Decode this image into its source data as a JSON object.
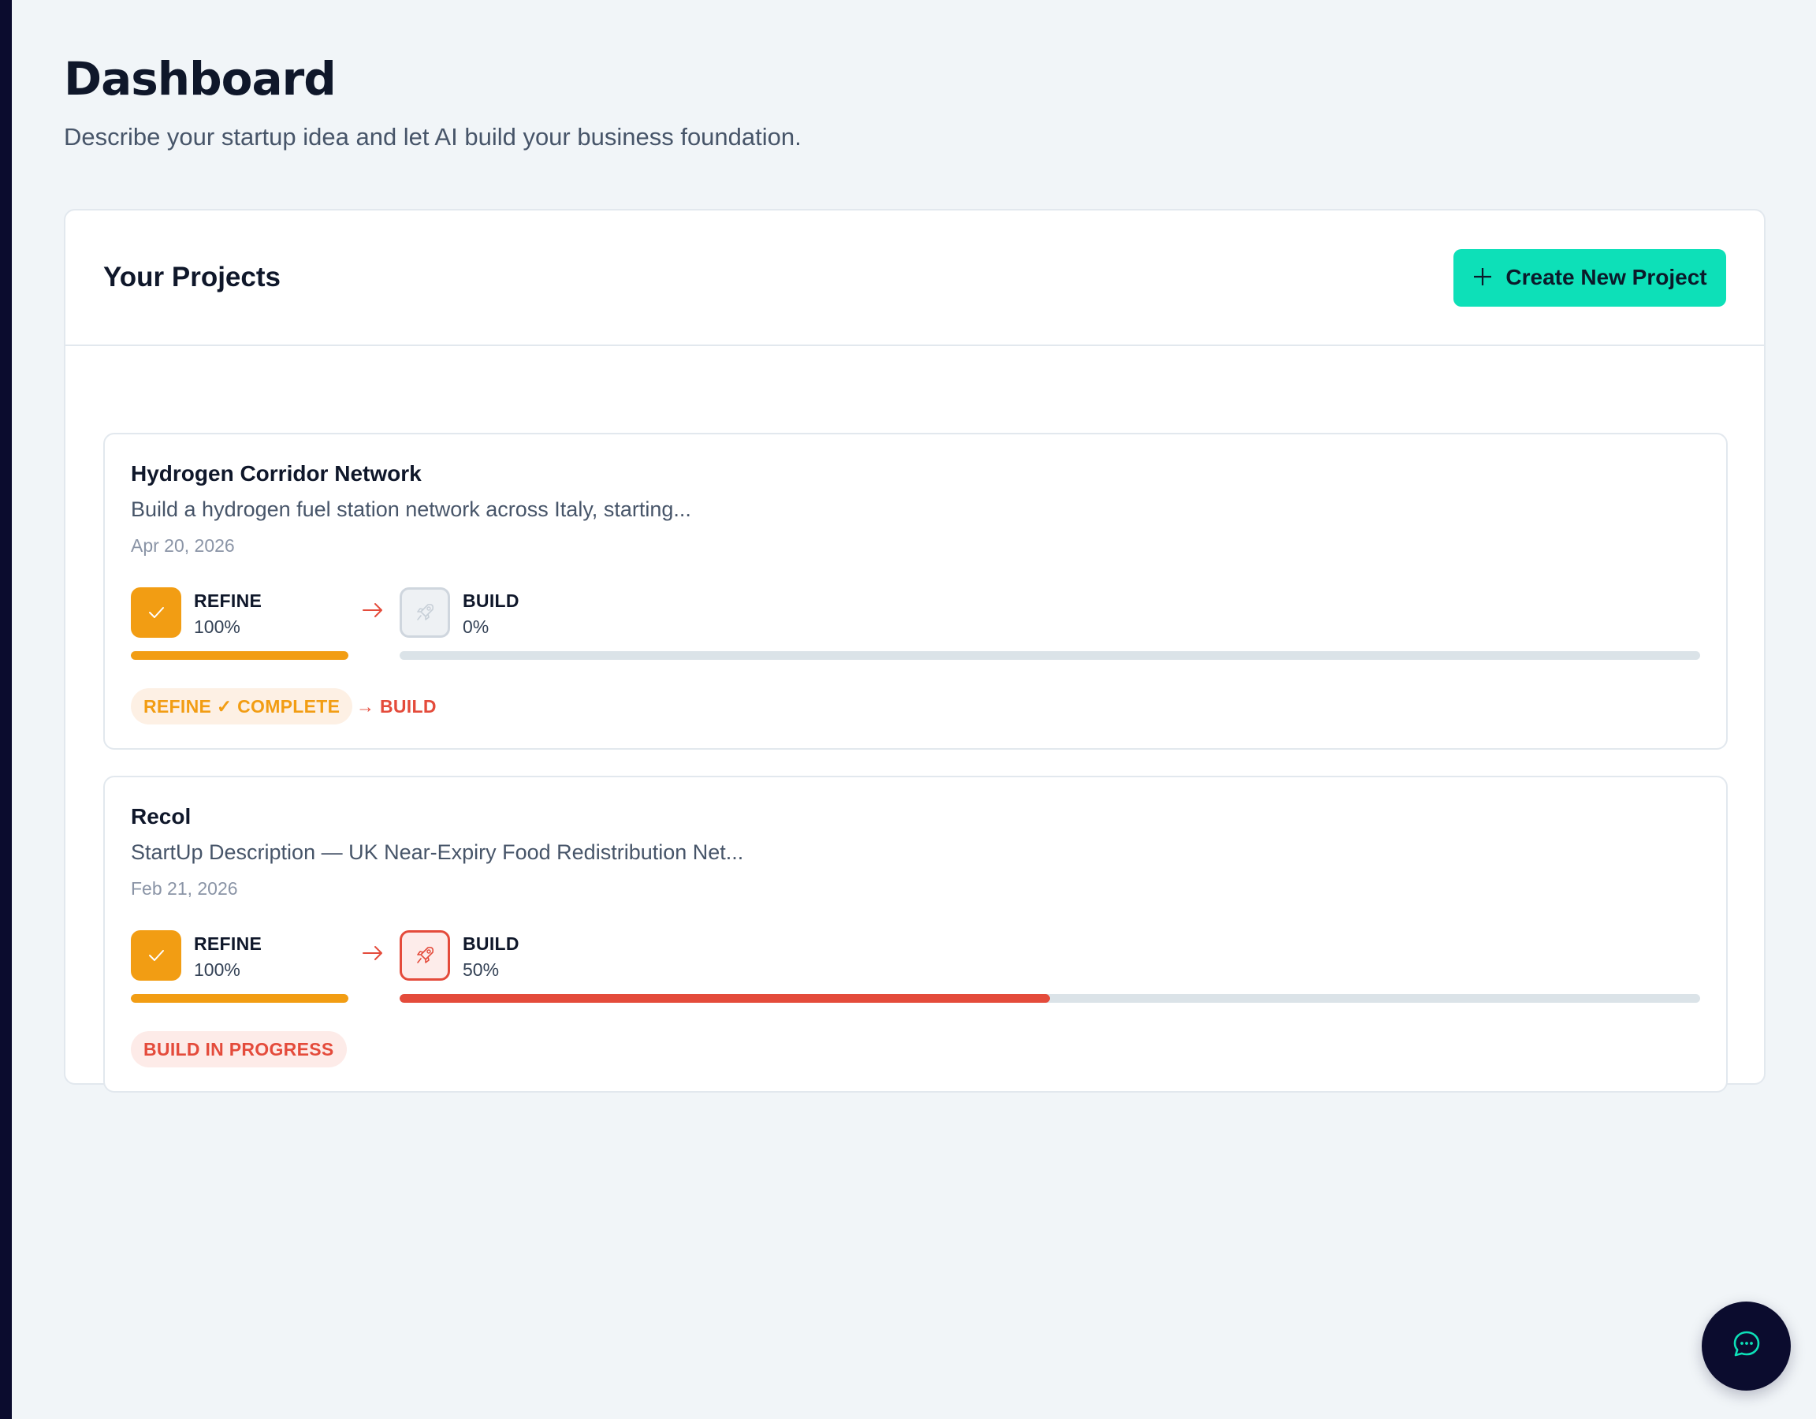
{
  "header": {
    "title": "Dashboard",
    "subtitle": "Describe your startup idea and let AI build your business foundation."
  },
  "projects_panel": {
    "title": "Your Projects",
    "create_button_label": "Create New Project",
    "create_button_icon": "plus-icon"
  },
  "projects": [
    {
      "name": "Hydrogen Corridor Network",
      "description": "Build a hydrogen fuel station network across Italy, starting...",
      "date": "Apr 20, 2026",
      "refine": {
        "label": "REFINE",
        "percent_text": "100%",
        "progress": 1.0
      },
      "build": {
        "label": "BUILD",
        "percent_text": "0%",
        "progress": 0.0
      },
      "status_pill": "REFINE ✓ COMPLETE",
      "next_step": "→ BUILD"
    },
    {
      "name": "Recol",
      "description": "StartUp Description — UK Near-Expiry Food Redistribution Net...",
      "date": "Feb 21, 2026",
      "refine": {
        "label": "REFINE",
        "percent_text": "100%",
        "progress": 1.0
      },
      "build": {
        "label": "BUILD",
        "percent_text": "50%",
        "progress": 0.5
      },
      "status_pill": "BUILD IN PROGRESS"
    }
  ],
  "chat_button": {
    "icon": "chat-bubble-icon"
  },
  "colors": {
    "accent": "#0de0b8",
    "refine": "#f29d13",
    "build": "#e44b3b",
    "background": "#f1f5f8",
    "dark": "#0b0c2e"
  }
}
